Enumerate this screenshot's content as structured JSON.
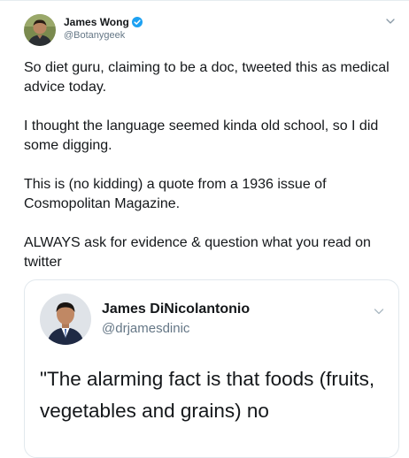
{
  "author": {
    "display_name": "James Wong",
    "handle": "@Botanygeek",
    "avatar_icon": "profile-photo-man-dark-jacket",
    "verified_icon": "verified-badge-icon"
  },
  "tweet": {
    "paragraphs": [
      "So diet guru, claiming to be a doc, tweeted this as medical advice today.",
      "I thought the language seemed kinda old school, so I did some digging.",
      "This is (no kidding) a quote from a 1936 issue of Cosmopolitan Magazine.",
      "ALWAYS ask for evidence & question what you read on twitter"
    ]
  },
  "quoted_tweet": {
    "display_name": "James DiNicolantonio",
    "handle": "@drjamesdinic",
    "avatar_icon": "profile-photo-man-suit",
    "text": "\"The alarming fact is that foods (fruits, vegetables and grains) no"
  },
  "colors": {
    "text": "#14171a",
    "secondary": "#657786",
    "verified": "#1da1f2",
    "border": "#e1e8ed"
  }
}
